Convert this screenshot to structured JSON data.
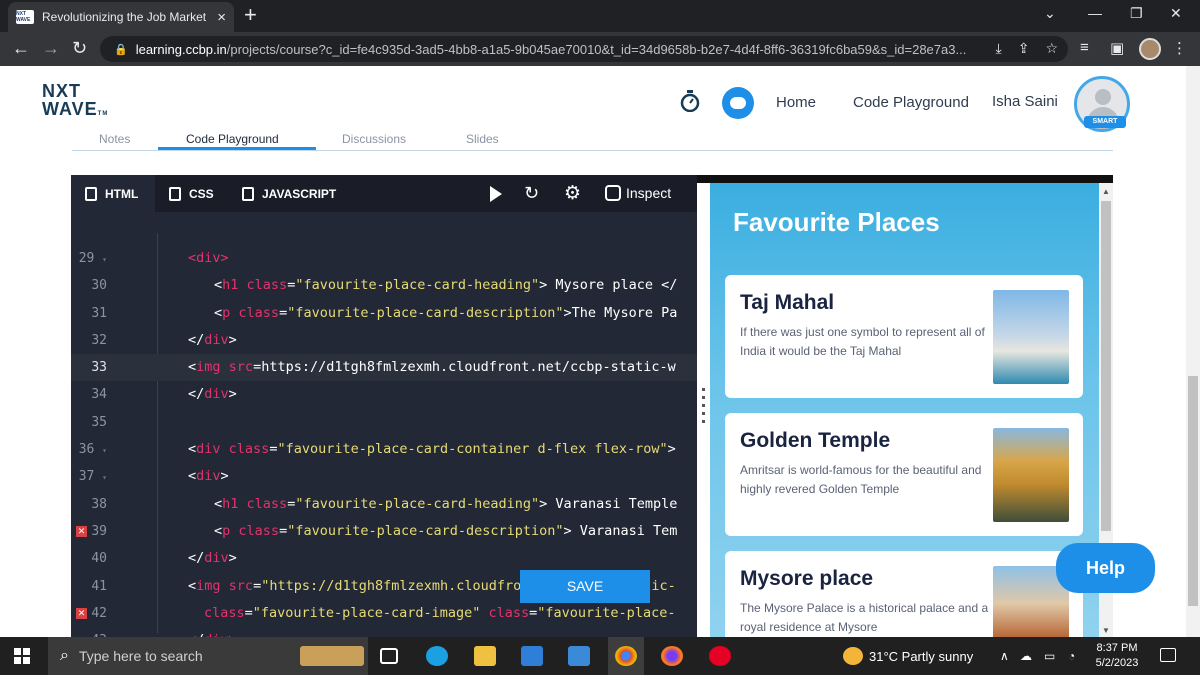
{
  "browser": {
    "tab_title": "Revolutionizing the Job Market |",
    "favicon_text": "NXT WAVE",
    "url_host": "learning.ccbp.in",
    "url_rest": "/projects/course?c_id=fe4c935d-3ad5-4bb8-a1a5-9b045ae70010&t_id=34d9658b-b2e7-4d4f-8ff6-36319fc6ba59&s_id=28e7a3..."
  },
  "header": {
    "logo_line1": "NXT",
    "logo_line2": "WAVE",
    "logo_tm": "TM",
    "nav_home": "Home",
    "nav_playground": "Code Playground",
    "username": "Isha Saini",
    "badge": "SMART"
  },
  "subtabs": [
    "Notes",
    "Code Playground",
    "Discussions",
    "Slides"
  ],
  "editor": {
    "tabs": [
      "HTML",
      "CSS",
      "JAVASCRIPT"
    ],
    "inspect_label": "Inspect",
    "save_label": "SAVE"
  },
  "code_lines": [
    {
      "n": "29"
    },
    {
      "n": "30"
    },
    {
      "n": "31"
    },
    {
      "n": "32"
    },
    {
      "n": "33"
    },
    {
      "n": "34"
    },
    {
      "n": "35"
    },
    {
      "n": "36"
    },
    {
      "n": "37"
    },
    {
      "n": "38"
    },
    {
      "n": "39"
    },
    {
      "n": "40"
    },
    {
      "n": "41"
    },
    {
      "n": "42"
    },
    {
      "n": "43"
    }
  ],
  "preview": {
    "heading": "Favourite Places",
    "cards": [
      {
        "title": "Taj Mahal",
        "desc": "If there was just one symbol to represent all of India it would be the Taj Mahal"
      },
      {
        "title": "Golden Temple",
        "desc": "Amritsar is world-famous for the beautiful and highly revered Golden Temple"
      },
      {
        "title": "Mysore place",
        "desc": "The Mysore Palace is a historical palace and a royal residence at Mysore"
      }
    ],
    "help_label": "Help"
  },
  "taskbar": {
    "search_placeholder": "Type here to search",
    "weather": "31°C  Partly sunny",
    "time": "8:37 PM",
    "date": "5/2/2023"
  }
}
